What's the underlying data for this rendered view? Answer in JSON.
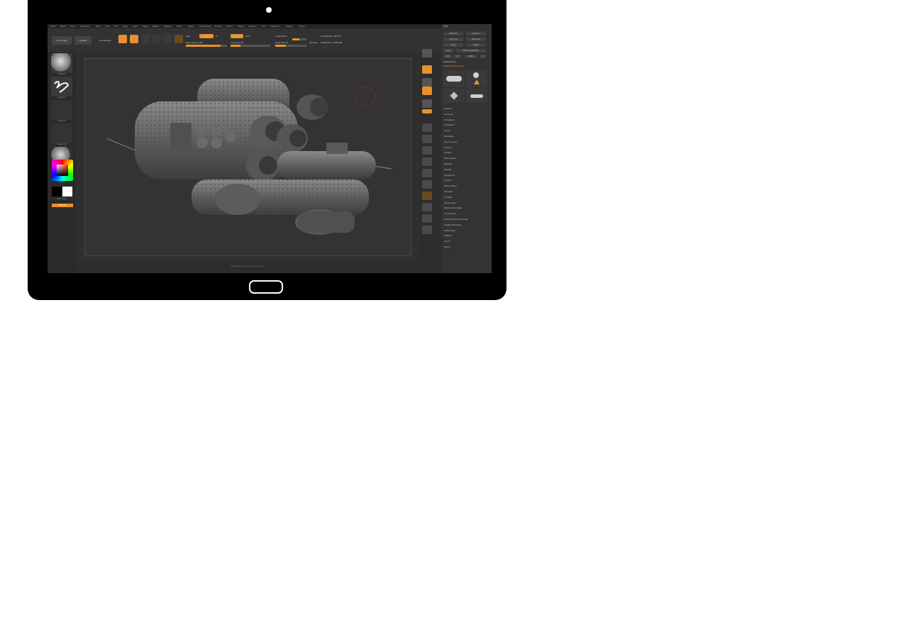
{
  "app": {
    "menu": [
      "Alpha",
      "Brush",
      "Color",
      "Document",
      "Draw",
      "Edit",
      "File",
      "Layer",
      "Light",
      "Macro",
      "Marker",
      "Material",
      "Movie",
      "Picker",
      "Preferences",
      "Render",
      "Stencil",
      "Stroke",
      "Texture",
      "Tool",
      "Transform",
      "Zplugin",
      "Zscript"
    ]
  },
  "toolbar": {
    "home_page": "Home Page",
    "lightbox": "LightBox",
    "live_boolean": "Live Boolean",
    "modes": [
      "Edit",
      "Draw",
      "Move",
      "Scale",
      "Rotate"
    ],
    "mrgb_label": "Mrgb",
    "rgb_label": "Rgb",
    "m_label": "M",
    "zadd_label": "Zadd",
    "zsub_label": "Zsub",
    "focal_shift_label": "Focal Shift 0",
    "draw_size_label": "Draw Size 64",
    "rgb_intensity_label": "Rgb Intensity 100",
    "z_intensity_label": "Z Intensity 25",
    "dynamic_label": "Dynamic",
    "active_points": "ActivePoints: 666,777",
    "total_points": "TotalPoints: 18.353 Mil",
    "draw_size_value": 0.35,
    "focal_value": 0.5,
    "rgb_value": 0.85,
    "z_value": 0.25
  },
  "left_shelf": {
    "items": [
      "Standard",
      "DragRect",
      "Alpha Off",
      "Texture Off",
      "BasicMaterial"
    ],
    "gradient_label": "Gradient",
    "switch_color_label": "SwitchColor",
    "alternate_label": "Alternate"
  },
  "tool_panel": {
    "title": "Tool",
    "buttons": [
      "Load Tool",
      "Save As",
      "Copy Tool",
      "Paste Tool",
      "Import",
      "Export",
      "Clone",
      "Make PolyMesh3D",
      "GoZ",
      "All",
      "Visible",
      "R"
    ],
    "lightbox_tools": "Lightbox▶Tools",
    "current_tool": "VWS10 Submarine_Poly",
    "subtools": [
      "Cylinder3D",
      "SimpleBrush",
      "PolyMesh3D",
      "VWS10 Submarine"
    ],
    "menu": [
      "Subtool",
      "Geometry",
      "ArrayMesh",
      "NanoMesh",
      "Layers",
      "FiberMesh",
      "Geometry HD",
      "Preview",
      "Surface",
      "Deformation",
      "Masking",
      "Visibility",
      "Polygroups",
      "Contact",
      "Morph Target",
      "Polypaint",
      "UV Map",
      "Texture Map",
      "Displacement Map",
      "Normal Map",
      "Vector Displacement Map",
      "Display Properties",
      "Unified Skin",
      "Initialize",
      "Import",
      "Export"
    ]
  },
  "right_shelf": {
    "labels": [
      "BPR",
      "SPix 3",
      "Scroll",
      "Zoom",
      "Actual",
      "AAHalf",
      "Persp",
      "Floor",
      "Local",
      "L.Sym",
      "Frame",
      "Move",
      "Scale",
      "Rotate",
      "Line Fill",
      "PolyF",
      "Transp",
      "Ghost",
      "Solo",
      "Xpose"
    ]
  },
  "viewport": {
    "hint": "Press Spacebar to show the brush menu"
  },
  "colors": {
    "accent": "#e8912d",
    "ui_dark": "#2d2d2d",
    "panel": "#333333"
  }
}
